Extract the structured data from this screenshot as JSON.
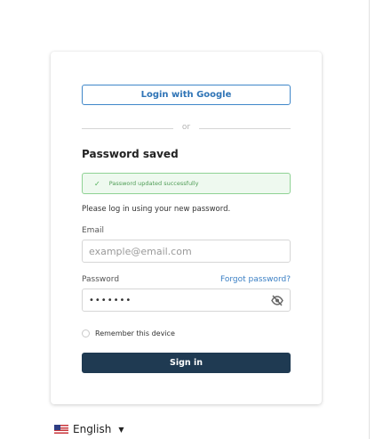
{
  "login": {
    "google_button": "Login with Google",
    "or_text": "or",
    "heading": "Password saved",
    "alert_text": "Password updated successfully",
    "info_text": "Please log in using your new password.",
    "email_label": "Email",
    "email_placeholder": "example@email.com",
    "password_label": "Password",
    "forgot_link": "Forgot password?",
    "password_value": "•••••••",
    "remember_label": "Remember this device",
    "signin_button": "Sign in"
  },
  "language": {
    "label": "English",
    "flag_icon": "us-flag-icon"
  },
  "colors": {
    "primary_dark": "#1f3a52",
    "link_blue": "#3a7fc4",
    "success_green": "#4e9c55"
  }
}
